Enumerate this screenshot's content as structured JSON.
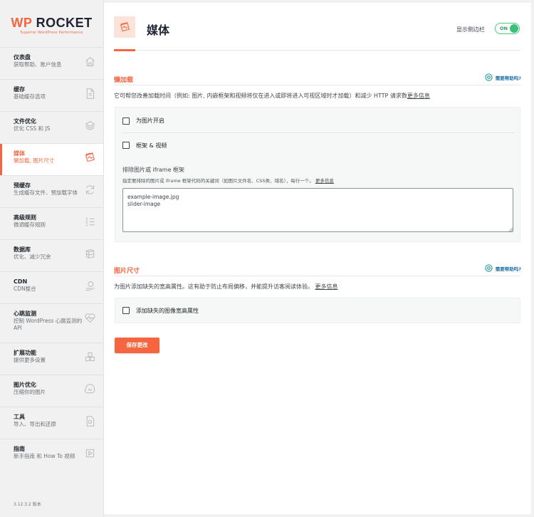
{
  "logo": {
    "main_wp": "WP",
    "main_rocket": " ROCKET",
    "sub": "Superior WordPress Performance"
  },
  "sidebar": {
    "items": [
      {
        "title": "仪表盘",
        "subtitle": "获取帮助、账户信息",
        "icon": "home-icon"
      },
      {
        "title": "缓存",
        "subtitle": "基础缓存选项",
        "icon": "document-icon"
      },
      {
        "title": "文件优化",
        "subtitle": "优化 CSS 和 JS",
        "icon": "layers-icon"
      },
      {
        "title": "媒体",
        "subtitle": "懒加载, 图片尺寸",
        "icon": "media-icon"
      },
      {
        "title": "预缓存",
        "subtitle": "生成缓存文件、预加载字体",
        "icon": "refresh-icon"
      },
      {
        "title": "高级规则",
        "subtitle": "微调缓存规则",
        "icon": "list-icon"
      },
      {
        "title": "数据库",
        "subtitle": "优化、减少冗余",
        "icon": "database-icon"
      },
      {
        "title": "CDN",
        "subtitle": "CDN整合",
        "icon": "cdn-icon"
      },
      {
        "title": "心跳监测",
        "subtitle": "控制 WordPress 心跳监测的 API",
        "icon": "heartbeat-icon"
      },
      {
        "title": "扩展功能",
        "subtitle": "提供更多设置",
        "icon": "addons-icon"
      },
      {
        "title": "图片优化",
        "subtitle": "压缩你的图片",
        "icon": "image-optimization-icon"
      },
      {
        "title": "工具",
        "subtitle": "导入、导出和还原",
        "icon": "tools-icon"
      },
      {
        "title": "指南",
        "subtitle": "新手指南 和 How To 视频",
        "icon": "play-icon"
      }
    ],
    "active_index": 3,
    "version": "3.12.3.2 版本"
  },
  "header": {
    "title": "媒体",
    "sidebar_toggle_label": "显示侧边栏",
    "toggle_state": "ON"
  },
  "lazyload": {
    "title": "懒加载",
    "help_label": "需要帮助吗?",
    "description": "它可帮您改善加载时间（例如: 图片, 内嵌框架和视频将仅在进入或即将进入可视区域时才加载）和减少 HTTP 请求数",
    "more_link": "更多信息",
    "option_images": "为图片开启",
    "option_iframes": "框架 & 视频",
    "exclude_title": "排除图片或 iframe 框架",
    "exclude_desc": "指定要排除的图片或 iframe 框架代码的关键词（如图片文件名、CSS类、域名），每行一个。",
    "exclude_more_link": "更多信息",
    "exclude_value": "example-image.jpg\nslider-image"
  },
  "image_dimensions": {
    "title": "图片尺寸",
    "help_label": "需要帮助吗?",
    "description": "为图片添加缺失的宽高属性。这有助于防止布局偏移，并能提升访客阅读体验。",
    "more_link": "更多信息",
    "option_add_missing": "添加缺失的图像宽高属性"
  },
  "save_button": "保存更改",
  "colors": {
    "accent": "#f56640",
    "toggle_on": "#3cc077",
    "help_link": "#1f6fa6"
  }
}
